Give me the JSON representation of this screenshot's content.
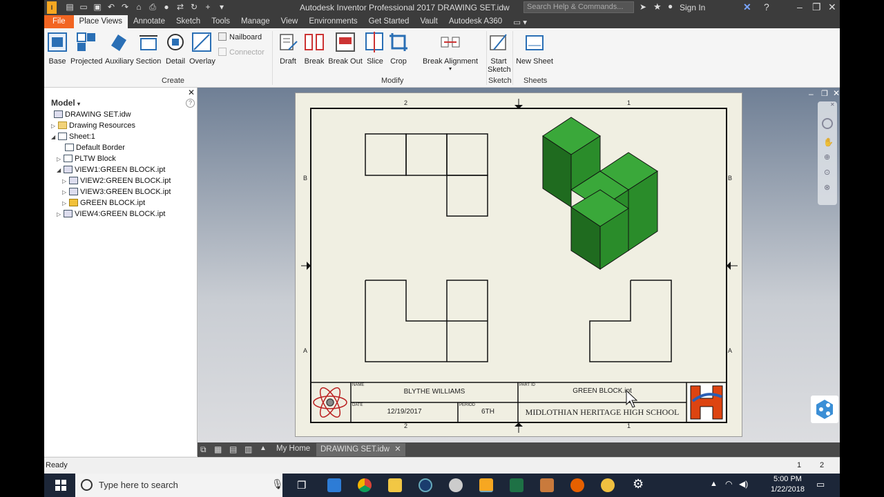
{
  "window": {
    "title": "Autodesk Inventor Professional 2017   DRAWING SET.idw",
    "search_placeholder": "Search Help & Commands...",
    "sign_in": "Sign In"
  },
  "ribbon_tabs": [
    "File",
    "Place Views",
    "Annotate",
    "Sketch",
    "Tools",
    "Manage",
    "View",
    "Environments",
    "Get Started",
    "Vault",
    "Autodesk A360"
  ],
  "ribbon": {
    "create": {
      "label": "Create",
      "buttons": [
        "Base",
        "Projected",
        "Auxiliary",
        "Section",
        "Detail",
        "Overlay"
      ],
      "nailboard": "Nailboard",
      "connector": "Connector"
    },
    "modify": {
      "label": "Modify",
      "buttons": [
        "Draft",
        "Break",
        "Break Out",
        "Slice",
        "Crop"
      ],
      "break_alignment": "Break Alignment"
    },
    "sketch": {
      "label": "Sketch",
      "start_sketch_1": "Start",
      "start_sketch_2": "Sketch"
    },
    "sheets": {
      "label": "Sheets",
      "new_sheet": "New Sheet"
    }
  },
  "browser": {
    "title": "Model",
    "items": [
      "DRAWING SET.idw",
      "Drawing Resources",
      "Sheet:1",
      "Default Border",
      "PLTW Block",
      "VIEW1:GREEN BLOCK.ipt",
      "VIEW2:GREEN BLOCK.ipt",
      "VIEW3:GREEN BLOCK.ipt",
      "GREEN BLOCK.ipt",
      "VIEW4:GREEN BLOCK.ipt"
    ]
  },
  "sheet": {
    "zone_top_left": "2",
    "zone_top_right": "1",
    "zone_left_upper": "B",
    "zone_left_lower": "A",
    "title_block": {
      "name_label": "NAME",
      "name": "BLYTHE WILLIAMS",
      "date_label": "DATE",
      "date": "12/19/2017",
      "period_label": "PERIOD",
      "period": "6TH",
      "part_label": "PART ID",
      "part": "GREEN BLOCK.ipt",
      "school": "MIDLOTHIAN HERITAGE HIGH SCHOOL"
    }
  },
  "doc_tabs": {
    "home": "My Home",
    "active": "DRAWING SET.idw"
  },
  "status": {
    "text": "Ready",
    "page1": "1",
    "page2": "2"
  },
  "taskbar": {
    "search_placeholder": "Type here to search",
    "time": "5:00 PM",
    "date": "1/22/2018"
  },
  "colors": {
    "accent": "#f26522",
    "iso_top": "#3aa83a",
    "iso_left": "#1f6b1f",
    "iso_right": "#2a8c2a"
  }
}
